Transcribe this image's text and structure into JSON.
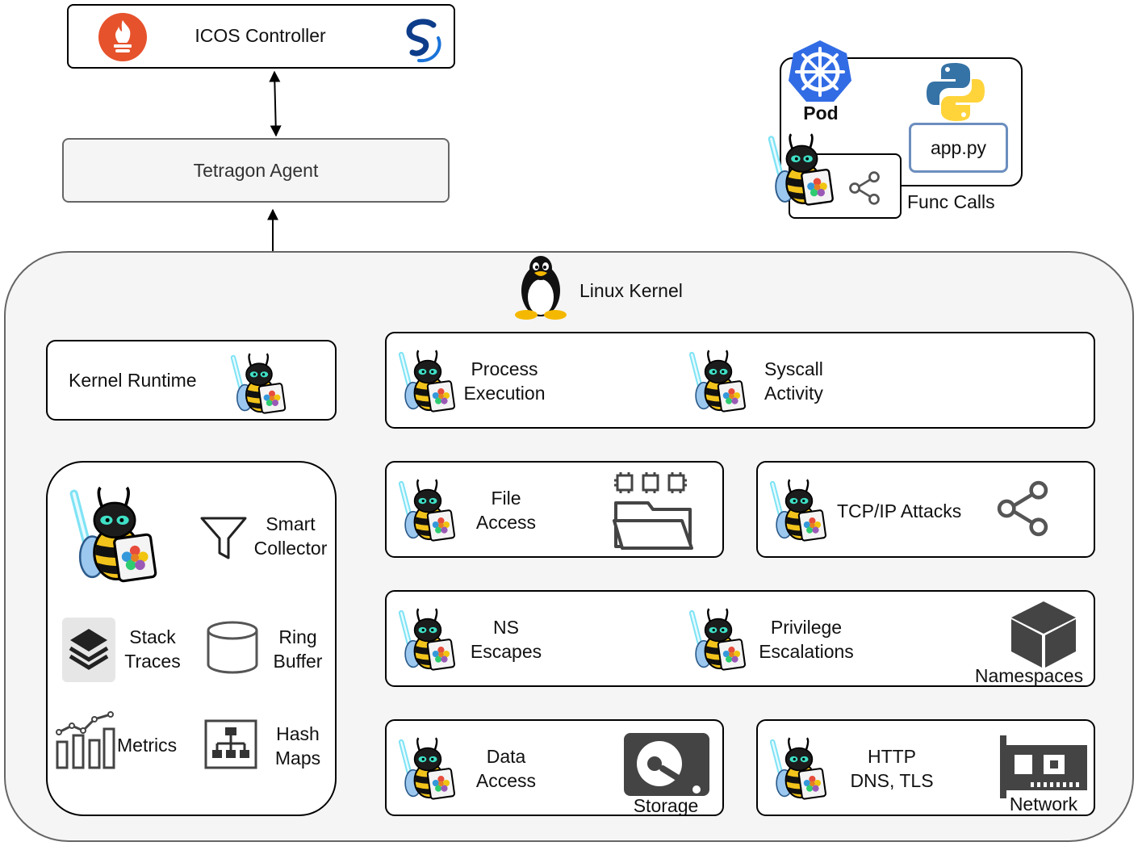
{
  "controller": {
    "label": "ICOS Controller",
    "icons": [
      "prometheus-icon",
      "ordering-logo-icon"
    ]
  },
  "agent": {
    "label": "Tetragon Agent"
  },
  "pod": {
    "label": "Pod",
    "app_file": "app.py",
    "func_calls": "Func Calls",
    "icons": [
      "kubernetes-icon",
      "python-icon",
      "tetragon-bee-icon",
      "share-icon"
    ]
  },
  "kernel": {
    "label": "Linux Kernel",
    "runtime": "Kernel Runtime",
    "collector": {
      "smart_1": "Smart",
      "smart_2": "Collector",
      "stack_1": "Stack",
      "stack_2": "Traces",
      "ring_1": "Ring",
      "ring_2": "Buffer",
      "metrics": "Metrics",
      "hash_1": "Hash",
      "hash_2": "Maps"
    },
    "modules": {
      "process_1": "Process",
      "process_2": "Execution",
      "syscall_1": "Syscall",
      "syscall_2": "Activity",
      "file_1": "File",
      "file_2": "Access",
      "tcp": "TCP/IP Attacks",
      "ns_1": "NS",
      "ns_2": "Escapes",
      "priv_1": "Privilege",
      "priv_2": "Escalations",
      "namespaces": "Namespaces",
      "data_1": "Data",
      "data_2": "Access",
      "storage": "Storage",
      "http_1": "HTTP",
      "http_2": "DNS, TLS",
      "network": "Network"
    }
  },
  "colors": {
    "kernel_bg": "#f5f5f5",
    "agent_bg": "#f5f5f5",
    "prometheus": "#e6522c",
    "kubernetes": "#326ce5",
    "python_blue": "#3572a5",
    "python_yellow": "#ffd43b",
    "app_border": "#6c8ebf",
    "bee_body": "#f2c31b",
    "lightsaber": "#7fe3f5"
  }
}
